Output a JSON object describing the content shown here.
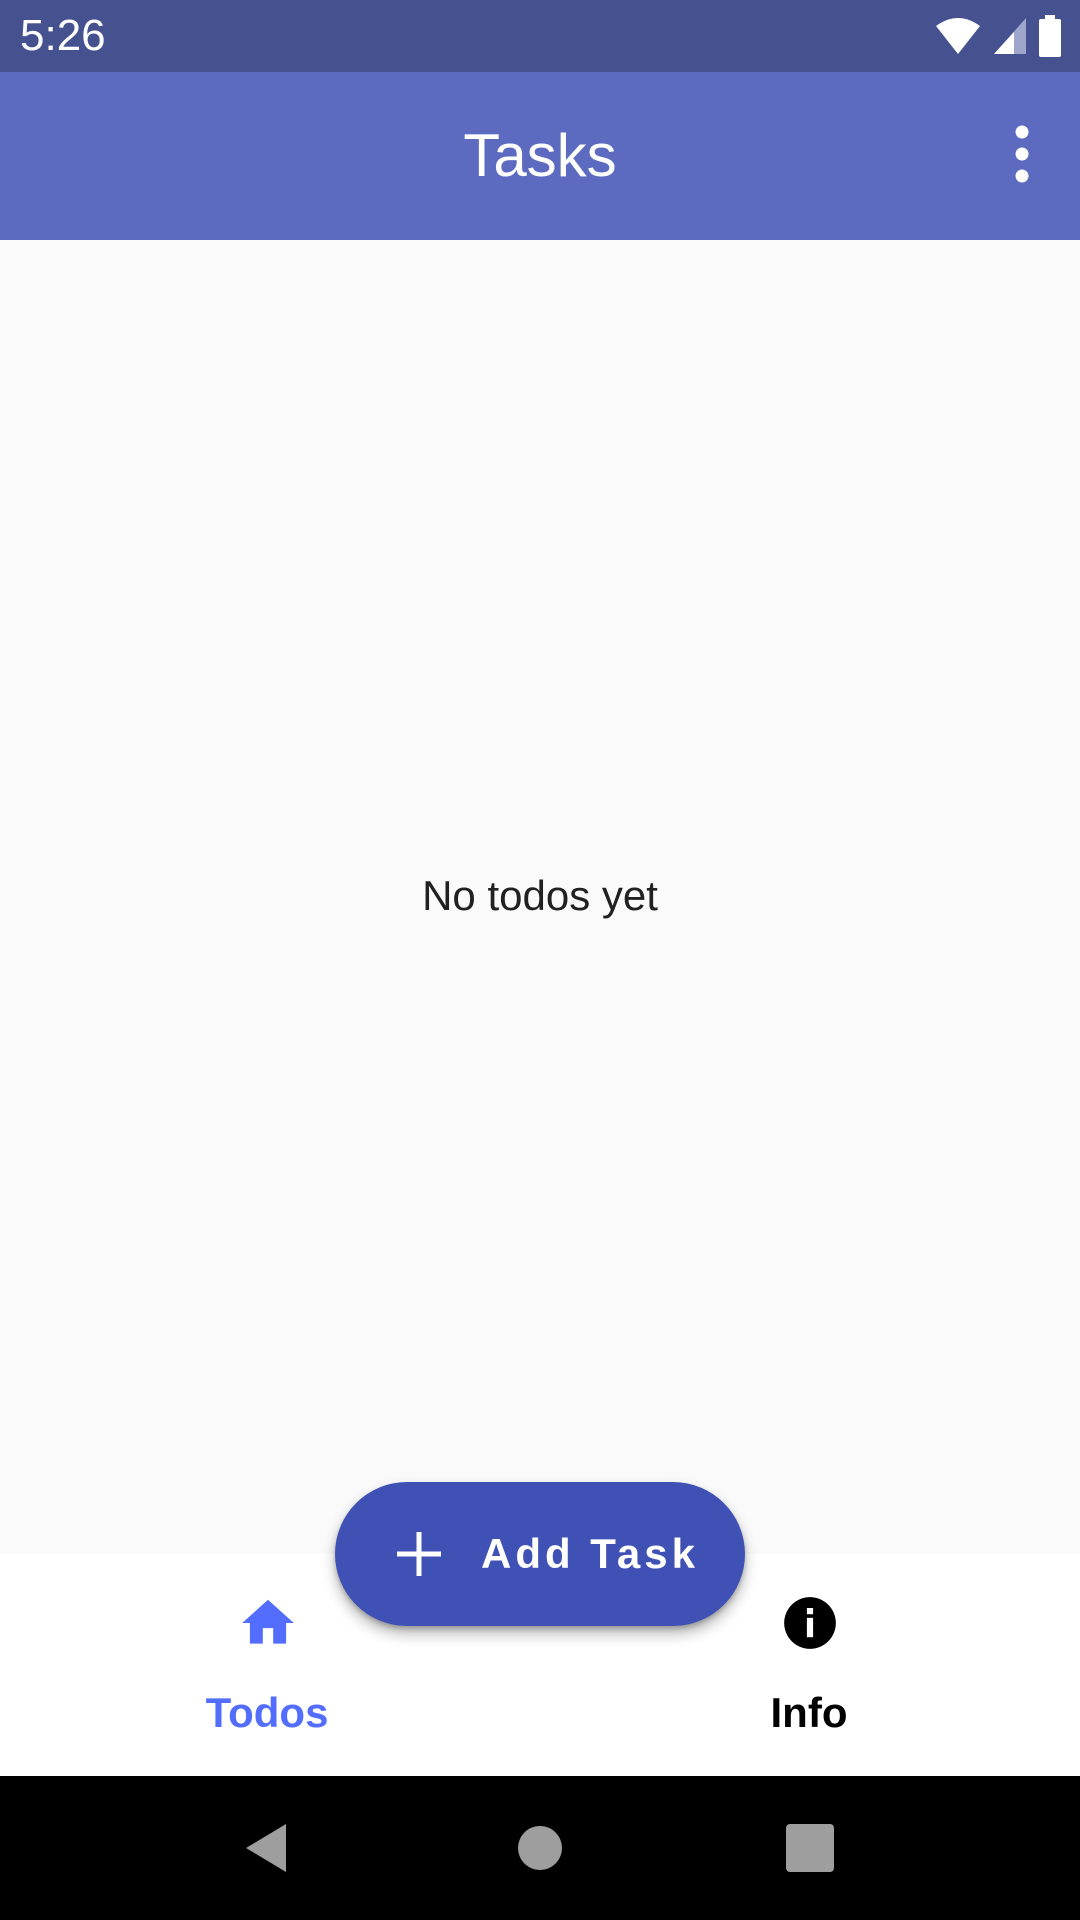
{
  "status_bar": {
    "time": "5:26",
    "icons": [
      "wifi-icon",
      "cell-signal-icon",
      "battery-icon"
    ],
    "color": "#45528f"
  },
  "app_bar": {
    "title": "Tasks",
    "color": "#5c6bc0",
    "menu_icon": "overflow-menu-icon"
  },
  "main": {
    "empty_message": "No todos yet"
  },
  "fab": {
    "label": "Add Task",
    "icon": "plus-icon",
    "color": "#3f51b5"
  },
  "bottom_nav": {
    "items": [
      {
        "label": "Todos",
        "icon": "home-icon",
        "selected": true,
        "color": "#536dfe"
      },
      {
        "label": "Info",
        "icon": "info-icon",
        "selected": false,
        "color": "#000000"
      }
    ]
  },
  "system_nav": {
    "buttons": [
      "back-icon",
      "home-circle-icon",
      "recents-icon"
    ]
  }
}
